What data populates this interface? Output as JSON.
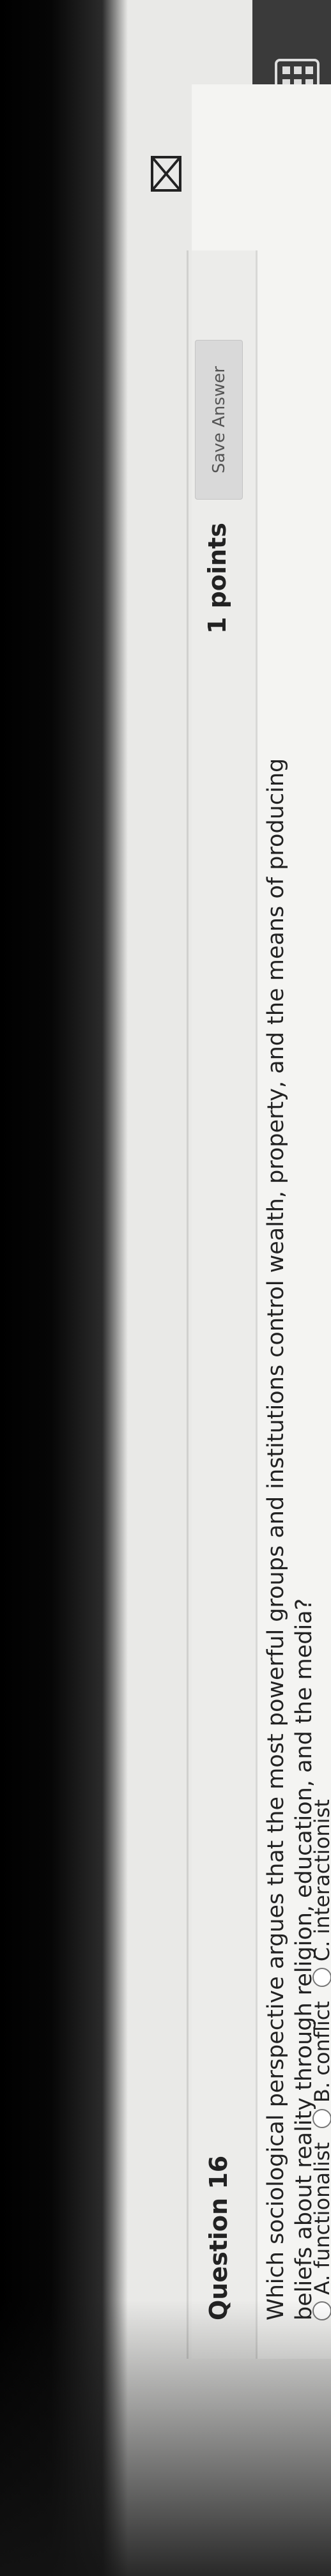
{
  "question": {
    "title": "Question 16",
    "points": "1 points",
    "save_label": "Save Answer",
    "text_line1": "Which sociological perspective argues that the most powerful groups and institutions control wealth, property, and the means of producing",
    "text_line2": "beliefs about reality through religion, education, and the media?",
    "options": [
      {
        "label": "A. functionalist"
      },
      {
        "label": "B. conflict"
      },
      {
        "label": "C. interactionist"
      }
    ]
  },
  "icons": {
    "grid": "grid-icon",
    "mail": "mail-icon",
    "notes": "notes-icon"
  },
  "colors": {
    "panel": "#f4f4f2",
    "text": "#222222",
    "button": "#d9d9d9"
  }
}
